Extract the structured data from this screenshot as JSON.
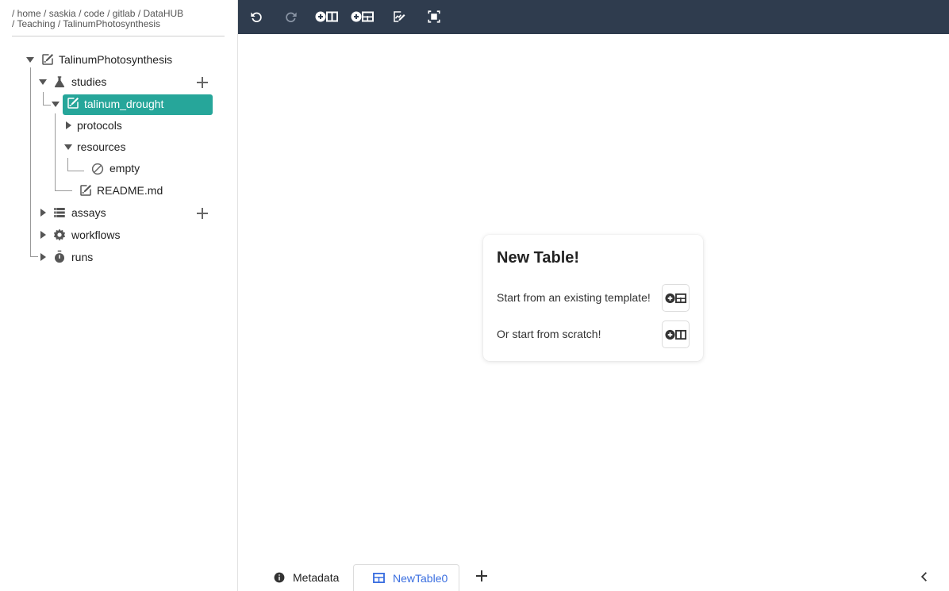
{
  "breadcrumb": {
    "line1": [
      "home",
      "saskia",
      "code",
      "gitlab",
      "DataHUB"
    ],
    "line2": [
      "Teaching",
      "TalinumPhotosynthesis"
    ]
  },
  "tree": {
    "root": {
      "label": "TalinumPhotosynthesis",
      "icon": "edit-note-icon"
    },
    "studies": {
      "label": "studies",
      "icon": "flask-icon"
    },
    "study": {
      "label": "talinum_drought",
      "icon": "edit-note-icon"
    },
    "protocols": {
      "label": "protocols"
    },
    "resources": {
      "label": "resources"
    },
    "empty": {
      "label": "empty",
      "icon": "block-icon"
    },
    "readme": {
      "label": "README.md",
      "icon": "edit-note-icon"
    },
    "assays": {
      "label": "assays",
      "icon": "list-icon"
    },
    "workflows": {
      "label": "workflows",
      "icon": "gear-icon"
    },
    "runs": {
      "label": "runs",
      "icon": "timer-icon"
    }
  },
  "toolbar": {
    "buttons": [
      "undo-icon",
      "redo-icon",
      "add-table-icon",
      "add-template-icon",
      "edit-annotation-icon",
      "fit-screen-icon"
    ]
  },
  "card": {
    "title": "New Table!",
    "template_text": "Start from an existing template!",
    "scratch_text": "Or start from scratch!"
  },
  "tabs": {
    "metadata": "Metadata",
    "table": "NewTable0"
  },
  "colors": {
    "toolbar_bg": "#2f3c4e",
    "selected_bg": "#26a69a",
    "active_tab": "#3b6fe0"
  }
}
